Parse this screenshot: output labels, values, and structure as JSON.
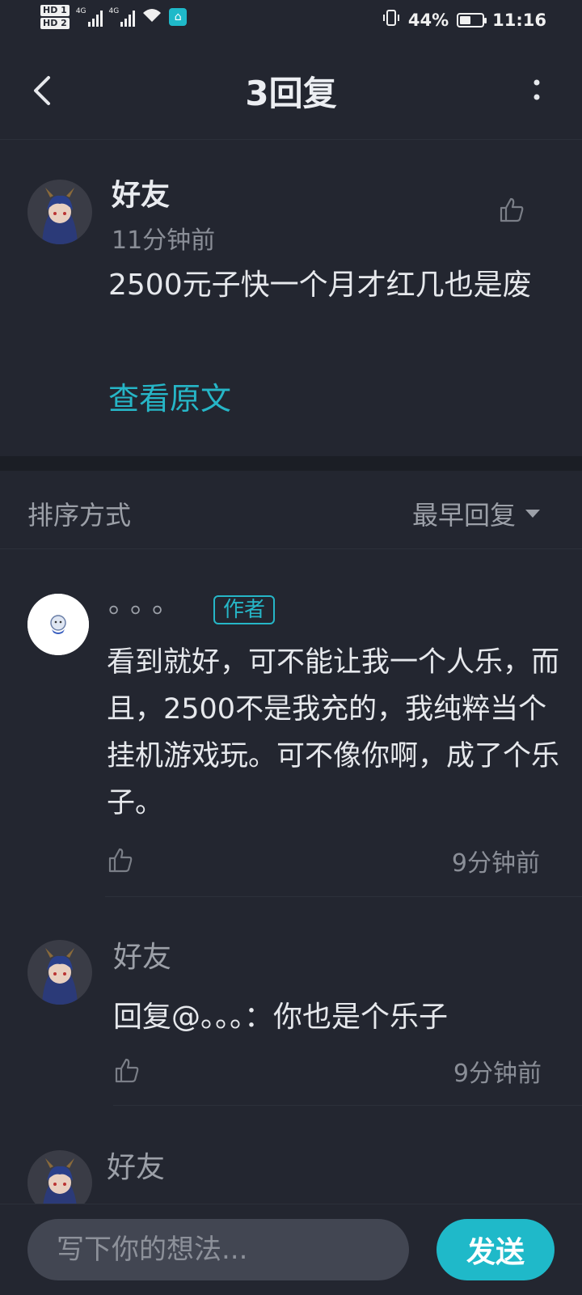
{
  "status_bar": {
    "network_1": "HD 1",
    "network_2": "HD 2",
    "signal_1": "4G",
    "signal_2": "4G",
    "battery_percent": "44%",
    "time": "11:16"
  },
  "header": {
    "title": "3回复"
  },
  "root_comment": {
    "username": "好友",
    "time": "11分钟前",
    "content": "2500元子快一个月才红几也是废",
    "view_original": "查看原文"
  },
  "sort": {
    "label": "排序方式",
    "selected": "最早回复"
  },
  "replies": [
    {
      "username": "。。。",
      "badge": "作者",
      "content": "看到就好，可不能让我一个人乐，而且，2500不是我充的，我纯粹当个挂机游戏玩。可不像你啊，成了个乐子。",
      "time": "9分钟前"
    },
    {
      "username": "好友",
      "content": "回复@。。。：你也是个乐子",
      "time": "9分钟前"
    },
    {
      "username": "好友"
    }
  ],
  "input": {
    "placeholder": "写下你的想法...",
    "send_label": "发送"
  },
  "colors": {
    "background": "#232630",
    "accent": "#1fb9c9",
    "muted_text": "#8a8e97"
  }
}
